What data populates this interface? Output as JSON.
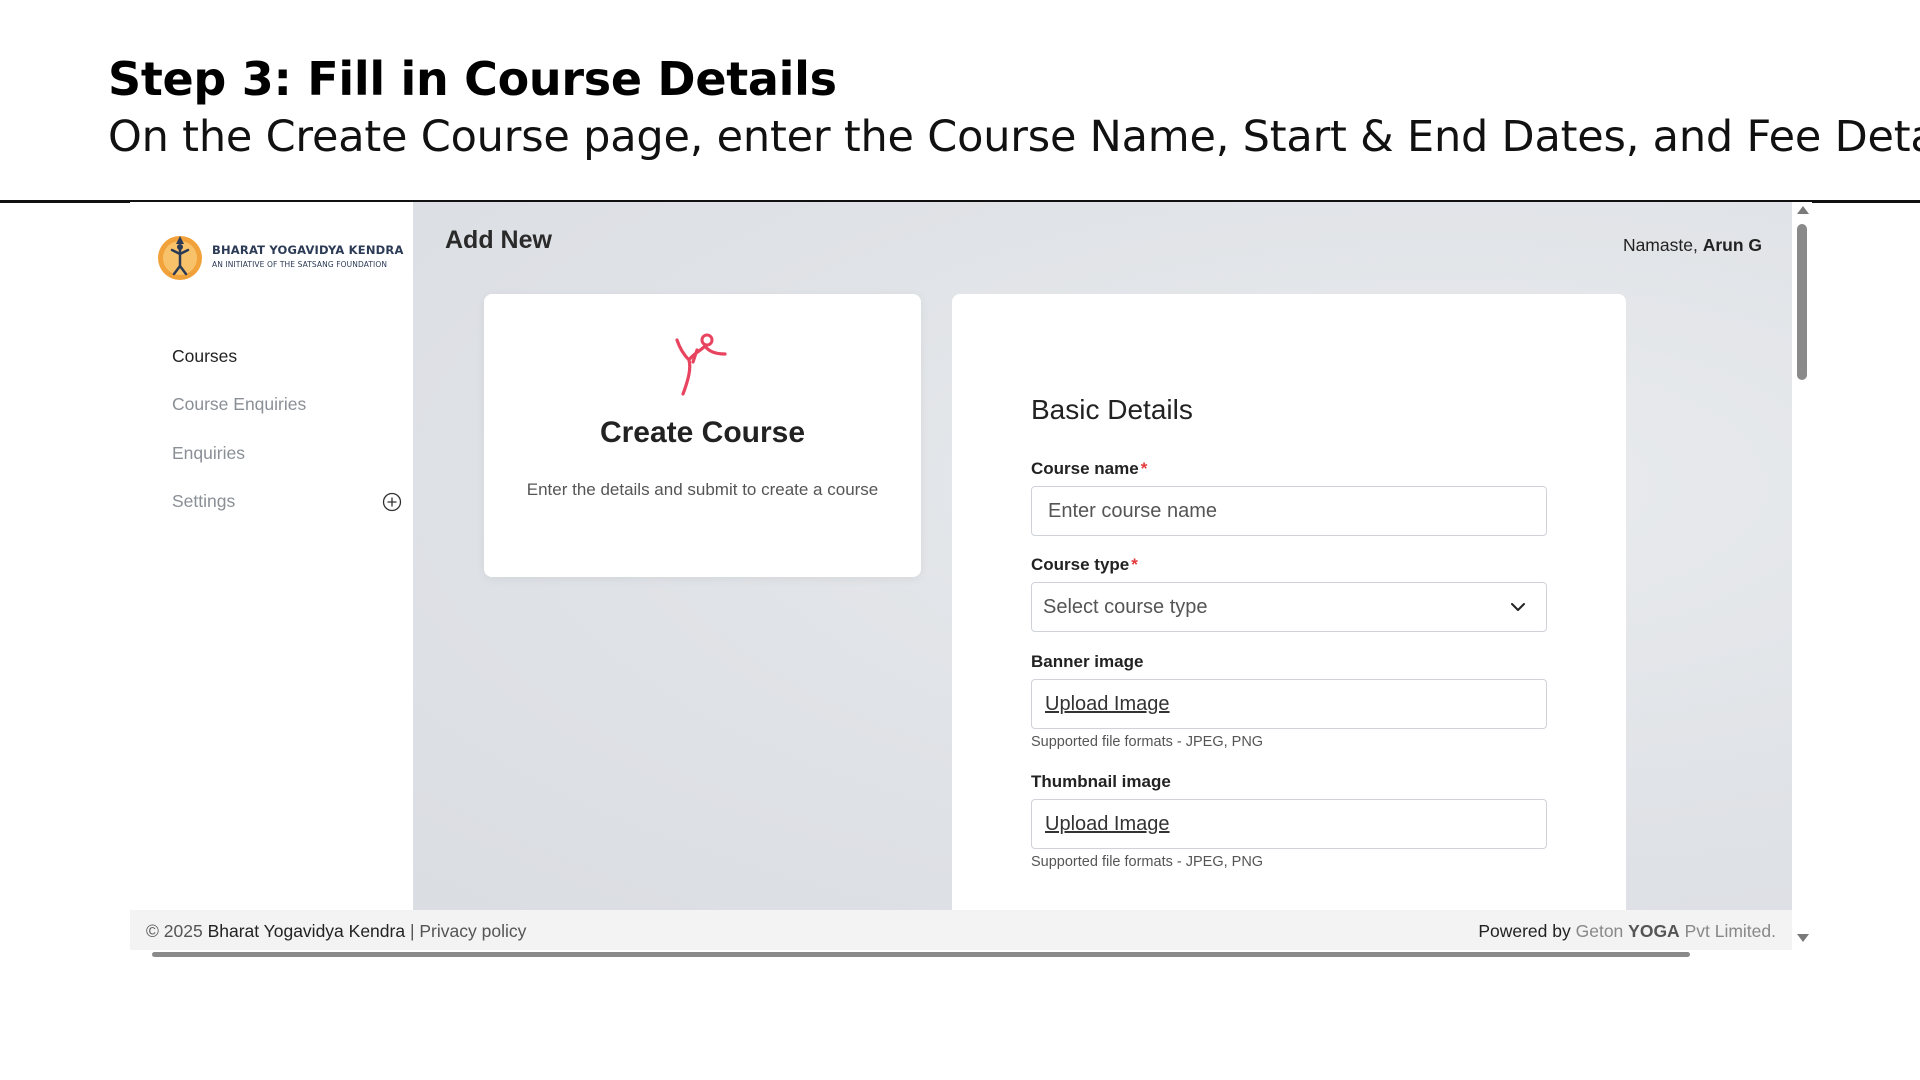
{
  "slide": {
    "title": "Step 3: Fill in Course Details",
    "subtitle": "On the Create Course page, enter the Course Name, Start & End Dates, and Fee Details."
  },
  "brand": {
    "name": "BHARAT YOGAVIDYA KENDRA",
    "tagline": "AN INITIATIVE OF THE SATSANG FOUNDATION"
  },
  "sidebar": {
    "items": [
      {
        "label": "Courses"
      },
      {
        "label": "Course Enquiries"
      },
      {
        "label": "Enquiries"
      },
      {
        "label": "Settings"
      }
    ]
  },
  "header": {
    "page_title": "Add New",
    "greeting_prefix": "Namaste, ",
    "user_name": "Arun G"
  },
  "create_card": {
    "title": "Create Course",
    "description": "Enter the details and submit to create a course"
  },
  "form": {
    "section_title": "Basic Details",
    "course_name": {
      "label": "Course name",
      "required_mark": "*",
      "placeholder": "Enter course name"
    },
    "course_type": {
      "label": "Course type",
      "required_mark": "*",
      "placeholder": "Select course type"
    },
    "banner_image": {
      "label": "Banner image",
      "upload_label": "Upload Image",
      "hint": "Supported file formats - JPEG, PNG"
    },
    "thumbnail_image": {
      "label": "Thumbnail image",
      "upload_label": "Upload Image",
      "hint": "Supported file formats - JPEG, PNG"
    }
  },
  "footer": {
    "copyright": "© 2025 ",
    "org": "Bharat Yogavidya Kendra",
    "separator": " | ",
    "privacy": "Privacy policy",
    "powered_prefix": "Powered by ",
    "geton": "Geton ",
    "yoga": "YOGA",
    "suffix": " Pvt Limited."
  },
  "colors": {
    "accent_pink": "#e8445f",
    "logo_orange": "#f2a23a",
    "brand_navy": "#2b3a55",
    "required_red": "#e23a3a"
  }
}
